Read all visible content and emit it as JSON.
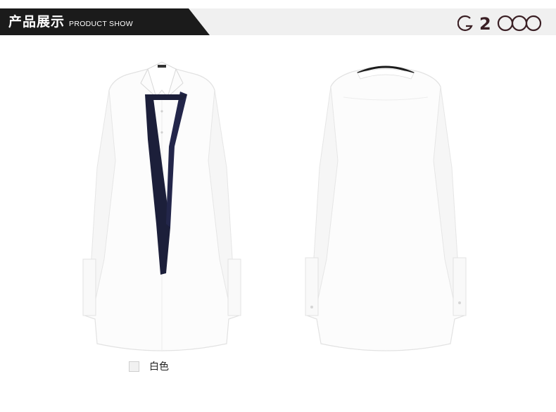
{
  "header": {
    "title_cn": "产品展示",
    "title_en": "PRODUCT SHOW",
    "brand": "G2000",
    "colors": {
      "bar_dark": "#1b1b1b",
      "bar_light": "#f0f0f0",
      "logo": "#3a1f24"
    }
  },
  "products": [
    {
      "view": "front",
      "icon": "shirt-front-with-tie"
    },
    {
      "view": "back",
      "icon": "shirt-back"
    }
  ],
  "color_option": {
    "label": "白色",
    "swatch_color": "#f1f1f1"
  }
}
